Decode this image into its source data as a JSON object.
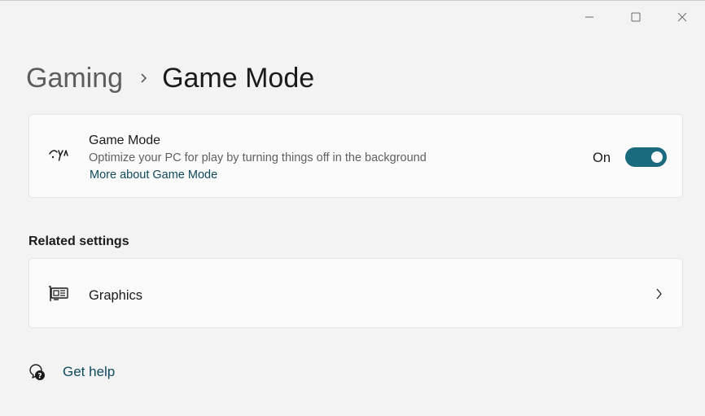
{
  "titlebar": {
    "minimize_icon": "minimize-icon",
    "maximize_icon": "maximize-icon",
    "close_icon": "close-icon"
  },
  "breadcrumb": {
    "parent": "Gaming",
    "separator_icon": "chevron-right-icon",
    "current": "Game Mode"
  },
  "game_mode_card": {
    "icon": "game-mode-icon",
    "title": "Game Mode",
    "description": "Optimize your PC for play by turning things off in the background",
    "link": "More about Game Mode",
    "toggle_state_label": "On",
    "toggle_on": true
  },
  "related_settings": {
    "header": "Related settings",
    "items": [
      {
        "label": "Graphics",
        "icon": "graphics-card-icon",
        "chevron": "chevron-right-icon"
      }
    ]
  },
  "help": {
    "icon": "get-help-icon",
    "label": "Get help"
  },
  "colors": {
    "accent": "#1b6b7e",
    "link": "#0f4a5c",
    "background": "#f3f3f3",
    "card": "#fbfbfb"
  }
}
